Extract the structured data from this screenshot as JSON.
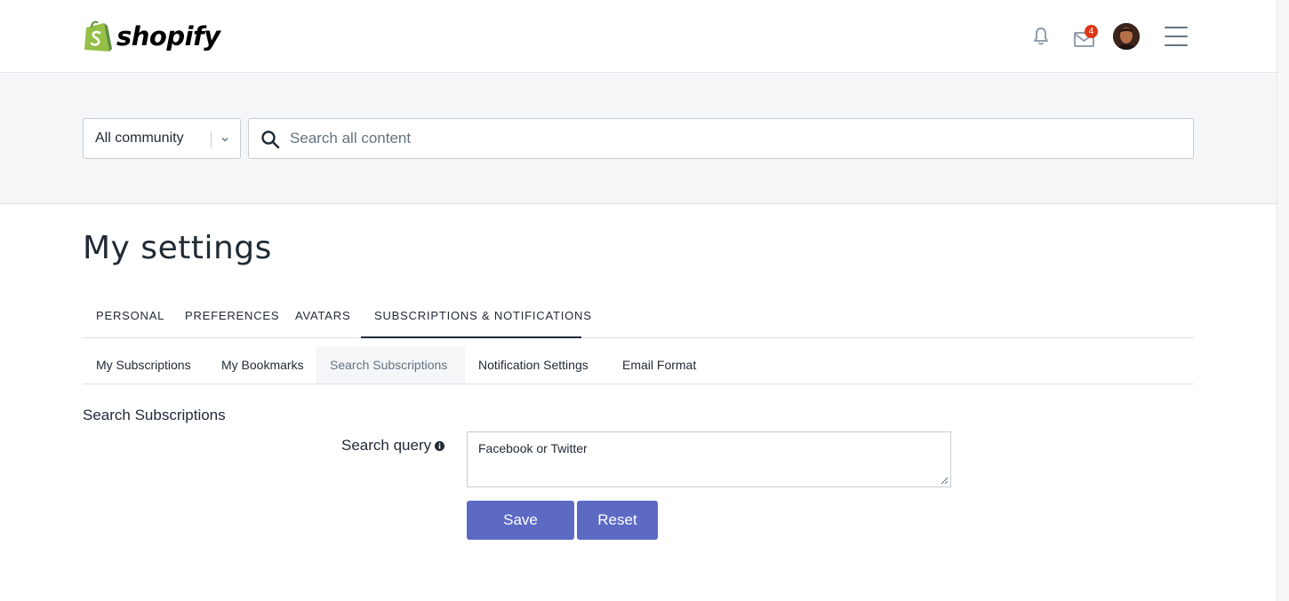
{
  "header": {
    "logo_text": "shopify",
    "notifications_icon": "bell-icon",
    "messages_icon": "envelope-icon",
    "messages_count": "4",
    "menu_icon": "hamburger-icon",
    "brand_color": "#95bf47"
  },
  "search": {
    "scope_selected": "All community",
    "placeholder": "Search all content"
  },
  "page": {
    "title": "My settings"
  },
  "tabs": [
    {
      "label": "Personal"
    },
    {
      "label": "Preferences"
    },
    {
      "label": "Avatars"
    },
    {
      "label": "Subscriptions & Notifications",
      "active": true
    }
  ],
  "subtabs": [
    {
      "label": "My Subscriptions"
    },
    {
      "label": "My Bookmarks"
    },
    {
      "label": "Search Subscriptions",
      "active": true
    },
    {
      "label": "Notification Settings"
    },
    {
      "label": "Email Format"
    }
  ],
  "form": {
    "section_title": "Search Subscriptions",
    "query_label": "Search query",
    "query_value": "Facebook or Twitter",
    "save_label": "Save",
    "reset_label": "Reset",
    "button_color": "#5c6ac4"
  }
}
